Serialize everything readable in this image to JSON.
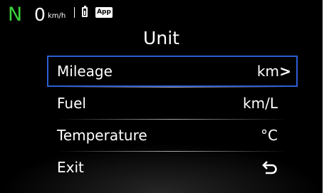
{
  "status": {
    "gear": "N",
    "speed": "0",
    "speed_unit": "km/h",
    "app_label": "App",
    "gear_color": "#3ad13a"
  },
  "title": "Unit",
  "menu": {
    "items": [
      {
        "label": "Mileage",
        "value": "km",
        "selected": true
      },
      {
        "label": "Fuel",
        "value": "km/L"
      },
      {
        "label": "Temperature",
        "value": "°C"
      },
      {
        "label": "Exit",
        "icon": "back-arrow-icon"
      }
    ],
    "selected_chevron": ">",
    "highlight_color": "#2d5fd4"
  }
}
